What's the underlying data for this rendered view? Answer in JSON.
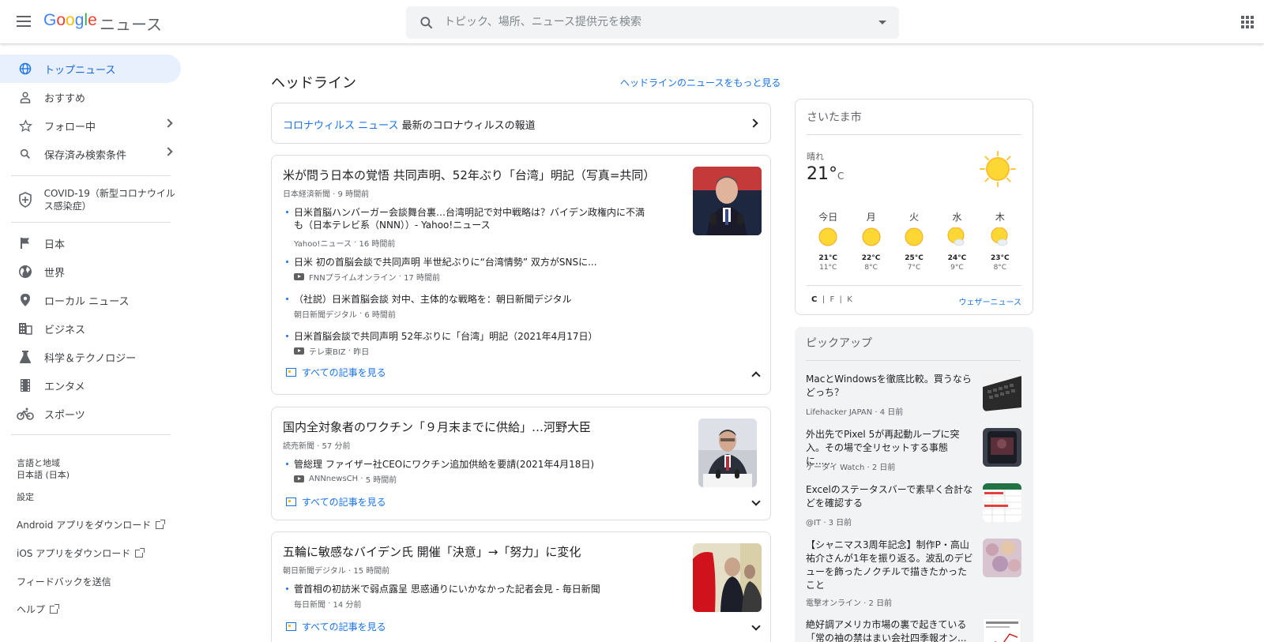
{
  "header": {
    "logo_letters": [
      "G",
      "o",
      "o",
      "g",
      "l",
      "e"
    ],
    "product": "ニュース",
    "search_placeholder": "トピック、場所、ニュース提供元を検索"
  },
  "sidebar": {
    "items": [
      {
        "label": "トップニュース",
        "icon": "globe-icon"
      },
      {
        "label": "おすすめ",
        "icon": "person-icon"
      },
      {
        "label": "フォロー中",
        "icon": "star-icon"
      },
      {
        "label": "保存済み検索条件",
        "icon": "search-icon"
      }
    ],
    "covid": "COVID-19（新型コロナウイルス感染症）",
    "sections": [
      {
        "label": "日本",
        "icon": "flag-icon"
      },
      {
        "label": "世界",
        "icon": "world-icon"
      },
      {
        "label": "ローカル ニュース",
        "icon": "location-pin-icon"
      },
      {
        "label": "ビジネス",
        "icon": "building-icon"
      },
      {
        "label": "科学＆テクノロジー",
        "icon": "flask-icon"
      },
      {
        "label": "エンタメ",
        "icon": "film-icon"
      },
      {
        "label": "スポーツ",
        "icon": "bicycle-icon"
      }
    ],
    "lang_label": "言語と地域",
    "lang_value": "日本語 (日本)",
    "settings": "設定",
    "android": "Android アプリをダウンロード",
    "ios": "iOS アプリをダウンロード",
    "feedback": "フィードバックを送信",
    "help": "ヘルプ"
  },
  "main": {
    "headline_title": "ヘッドライン",
    "headline_more": "ヘッドラインのニュースをもっと見る",
    "covid_card": {
      "keyword": "コロナウィルス ニュース",
      "text": " 最新のコロナウィルスの報道"
    },
    "all_articles": "すべての記事を見る",
    "stories": [
      {
        "title": "米が問う日本の覚悟 共同声明、52年ぶり「台湾」明記（写真=共同）",
        "source": "日本経済新聞",
        "time": "9 時間前",
        "subs": [
          {
            "title": "日米首脳ハンバーガー会談舞台裏…台湾明記で対中戦略は？バイデン政権内に不満も（日本テレビ系（NNN））- Yahoo!ニュース",
            "source": "Yahoo!ニュース",
            "time": "16 時間前",
            "video": false
          },
          {
            "title": "日米 初の首脳会談で共同声明 半世紀ぶりに“台湾情勢” 双方がSNSに...",
            "source": "FNNプライムオンライン",
            "time": "17 時間前",
            "video": true
          },
          {
            "title": "（社説）日米首脳会談 対中、主体的な戦略を：朝日新聞デジタル",
            "source": "朝日新聞デジタル",
            "time": "6 時間前",
            "video": false
          },
          {
            "title": "日米首脳会談で共同声明 52年ぶりに「台湾」明記（2021年4月17日）",
            "source": "テレ東BIZ",
            "time": "昨日",
            "video": true
          }
        ]
      },
      {
        "title": "国内全対象者のワクチン「９月末までに供給」…河野大臣",
        "source": "読売新聞",
        "time": "57 分前",
        "subs": [
          {
            "title": "管総理 ファイザー社CEOにワクチン追加供給を要請(2021年4月18日)",
            "source": "ANNnewsCH",
            "time": "5 時間前",
            "video": true
          }
        ]
      },
      {
        "title": "五輪に敏感なバイデン氏 開催「決意」→「努力」に変化",
        "source": "朝日新聞デジタル",
        "time": "15 時間前",
        "subs": [
          {
            "title": "菅首相の初訪米で弱点露呈 思惑通りにいかなかった記者会見 - 毎日新聞",
            "source": "毎日新聞",
            "time": "14 分前",
            "video": false
          }
        ]
      }
    ]
  },
  "weather": {
    "city": "さいたま市",
    "condition": "晴れ",
    "temp": "21°",
    "unit": "C",
    "days": [
      {
        "name": "今日",
        "hi": "21°C",
        "lo": "11°C",
        "icon": "sun-icon"
      },
      {
        "name": "月",
        "hi": "22°C",
        "lo": "8°C",
        "icon": "sun-icon"
      },
      {
        "name": "火",
        "hi": "25°C",
        "lo": "7°C",
        "icon": "sun-icon"
      },
      {
        "name": "水",
        "hi": "24°C",
        "lo": "9°C",
        "icon": "partly-sunny-icon"
      },
      {
        "name": "木",
        "hi": "23°C",
        "lo": "8°C",
        "icon": "partly-sunny-icon"
      }
    ],
    "units": [
      "C",
      "F",
      "K"
    ],
    "more": "ウェザーニュース"
  },
  "pickup": {
    "title": "ピックアップ",
    "items": [
      {
        "title": "MacとWindowsを徹底比較。買うならどっち？",
        "source": "Lifehacker JAPAN",
        "time": "4 日前"
      },
      {
        "title": "外出先でPixel 5が再起動ループに突入。その場で全リセットする事態に......",
        "source": "ケータイ Watch",
        "time": "2 日前"
      },
      {
        "title": "Excelのステータスバーで素早く合計などを確認する",
        "source": "@IT",
        "time": "3 日前"
      },
      {
        "title": "【シャニマス3周年記念】制作P・高山祐介さんが1年を振り返る。波乱のデビューを飾ったノクチルで描きたかったこと",
        "source": "電撃オンライン",
        "time": "2 日前"
      },
      {
        "title": "絶好調アメリカ市場の裏で起きている「常の袖の禁はまい会社四季報オン...",
        "source": "",
        "time": ""
      }
    ]
  }
}
